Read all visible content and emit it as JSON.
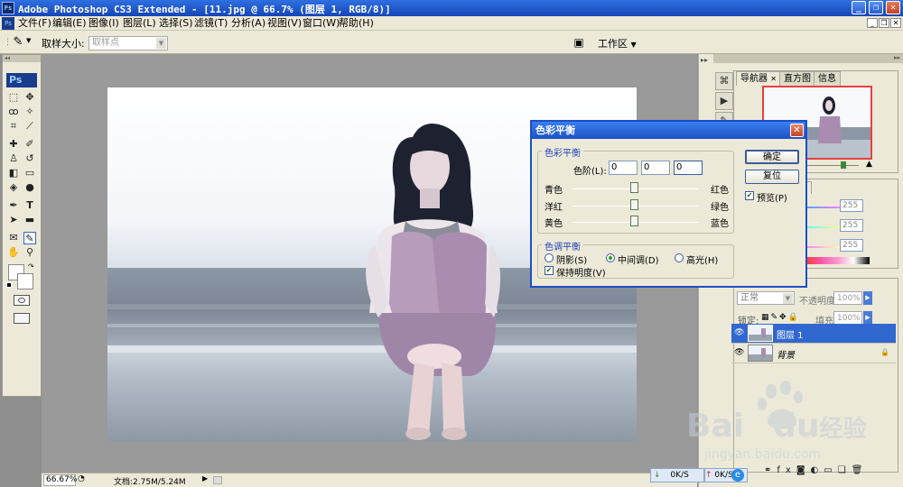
{
  "titlebar": {
    "title": "Adobe Photoshop CS3 Extended - [11.jpg @ 66.7% (图层 1, RGB/8)]"
  },
  "menu": [
    "文件(F)",
    "编辑(E)",
    "图像(I)",
    "图层(L)",
    "选择(S)",
    "滤镜(T)",
    "分析(A)",
    "视图(V)",
    "窗口(W)",
    "帮助(H)"
  ],
  "options": {
    "sample_size_label": "取样大小:",
    "sample_size_value": "取样点",
    "workspace_label": "工作区"
  },
  "tools": {
    "logo": "Ps"
  },
  "panels": {
    "tabs": [
      "导航器",
      "直方图",
      "信息"
    ],
    "partial_tab": "式",
    "swatch_values": [
      "255",
      "255",
      "255"
    ],
    "blend_mode": "正常",
    "opacity_label": "不透明度:",
    "opacity_value": "100%",
    "lock_label": "锁定:",
    "fill_label": "填充:",
    "fill_value": "100%",
    "layers": [
      {
        "name": "图层 1",
        "selected": true
      },
      {
        "name": "背景",
        "selected": false
      }
    ]
  },
  "dialog": {
    "title": "色彩平衡",
    "group_balance": "色彩平衡",
    "levels_label": "色阶(L):",
    "levels": [
      "0",
      "0",
      "0"
    ],
    "sliders": [
      {
        "left": "青色",
        "right": "红色",
        "value": 0
      },
      {
        "left": "洋红",
        "right": "绿色",
        "value": 0
      },
      {
        "left": "黄色",
        "right": "蓝色",
        "value": 0
      }
    ],
    "group_tone": "色调平衡",
    "tones": [
      {
        "label": "阴影(S)",
        "selected": false
      },
      {
        "label": "中间调(D)",
        "selected": true
      },
      {
        "label": "高光(H)",
        "selected": false
      }
    ],
    "preserve_label": "保持明度(V)",
    "preserve_checked": true,
    "ok_label": "确定",
    "cancel_label": "复位",
    "preview_label": "预览(P)",
    "preview_checked": true
  },
  "status": {
    "zoom": "66.67%",
    "doc": "文档:2.75M/5.24M"
  },
  "network": {
    "down": "0K/S",
    "up": "0K/S"
  },
  "watermark": {
    "brand": "Bai",
    "brand2": "du",
    "cn": "经验",
    "url": "jingyan.baidu.com"
  },
  "colors": {
    "titlebar": "#1c52c8",
    "chrome": "#ece9d8",
    "workspace": "#9a9a9a",
    "selected_layer": "#3168d0"
  }
}
